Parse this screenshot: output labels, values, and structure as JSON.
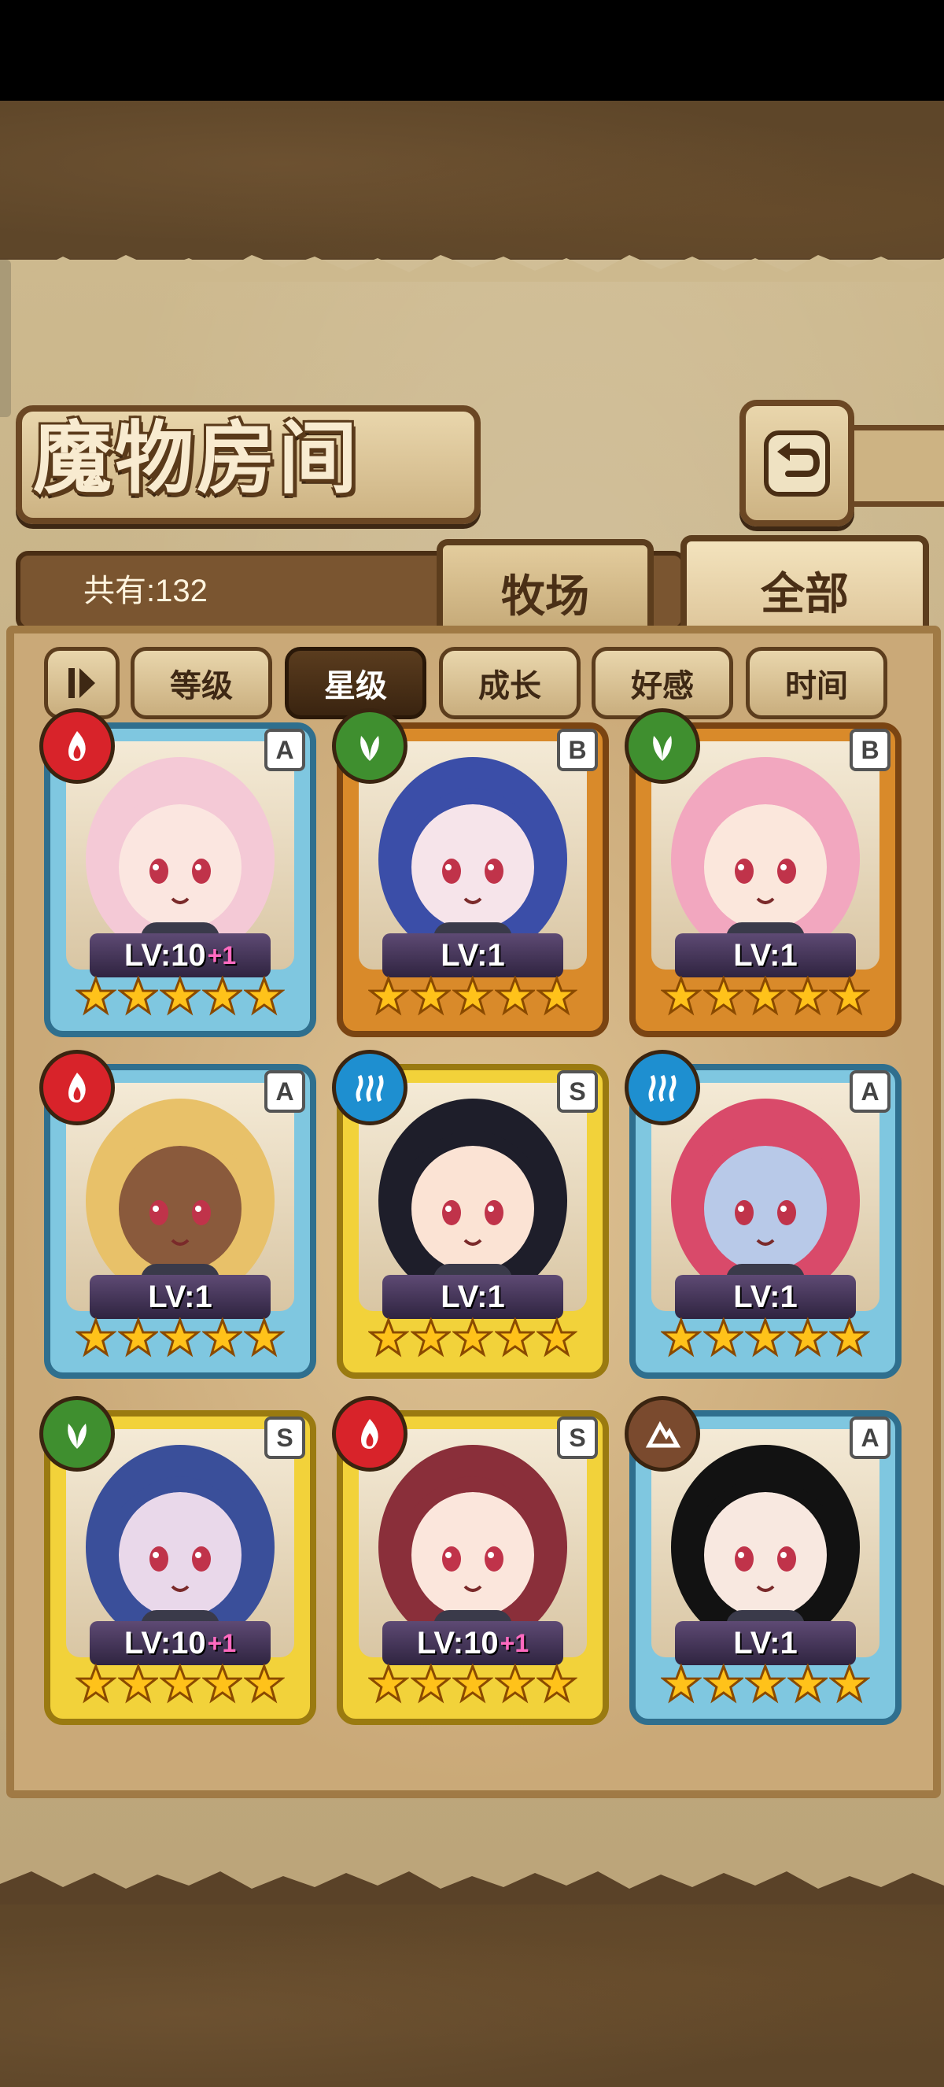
{
  "header": {
    "title": "魔物房间",
    "back_icon": "return-arrow-icon"
  },
  "summary": {
    "total_label": "共有:132"
  },
  "tabs": [
    {
      "label": "牧场",
      "active": false
    },
    {
      "label": "全部",
      "active": true
    }
  ],
  "sort": {
    "toggle_icon": "sort-direction-icon",
    "options": [
      {
        "label": "等级",
        "active": false
      },
      {
        "label": "星级",
        "active": true
      },
      {
        "label": "成长",
        "active": false
      },
      {
        "label": "好感",
        "active": false
      },
      {
        "label": "时间",
        "active": false
      }
    ]
  },
  "colors": {
    "frame_blue": "#7fc7e0",
    "frame_orange": "#d98a2a",
    "frame_gold": "#f2d23a",
    "fire": "#d8232a",
    "nature": "#3f8f2f",
    "water": "#1e8fd0",
    "earth": "#7a4a2e"
  },
  "cards": [
    {
      "level": "LV:10",
      "plus": "+1",
      "stars": 5,
      "element": "fire",
      "rank": "A",
      "frame": "blue",
      "hair": "#f4c9d6",
      "skin": "#fbe6e0"
    },
    {
      "level": "LV:1",
      "plus": "",
      "stars": 5,
      "element": "nature",
      "rank": "B",
      "frame": "orange",
      "hair": "#3b4ea8",
      "skin": "#f6e4ea"
    },
    {
      "level": "LV:1",
      "plus": "",
      "stars": 5,
      "element": "nature",
      "rank": "B",
      "frame": "orange",
      "hair": "#f2a7bf",
      "skin": "#fbe7dc"
    },
    {
      "level": "LV:1",
      "plus": "",
      "stars": 5,
      "element": "fire",
      "rank": "A",
      "frame": "blue",
      "hair": "#e8c169",
      "skin": "#8a5a3c"
    },
    {
      "level": "LV:1",
      "plus": "",
      "stars": 5,
      "element": "water",
      "rank": "S",
      "frame": "gold",
      "hair": "#1e1e2a",
      "skin": "#fbe3d4"
    },
    {
      "level": "LV:1",
      "plus": "",
      "stars": 5,
      "element": "water",
      "rank": "A",
      "frame": "blue",
      "hair": "#d94a6a",
      "skin": "#b8c9e8"
    },
    {
      "level": "LV:10",
      "plus": "+1",
      "stars": 5,
      "element": "nature",
      "rank": "S",
      "frame": "gold",
      "hair": "#3a4f9a",
      "skin": "#e9d8ea"
    },
    {
      "level": "LV:10",
      "plus": "+1",
      "stars": 5,
      "element": "fire",
      "rank": "S",
      "frame": "gold",
      "hair": "#8a2f3a",
      "skin": "#fbe6dc"
    },
    {
      "level": "LV:1",
      "plus": "",
      "stars": 5,
      "element": "earth",
      "rank": "A",
      "frame": "blue",
      "hair": "#121212",
      "skin": "#f8e8e0"
    }
  ]
}
